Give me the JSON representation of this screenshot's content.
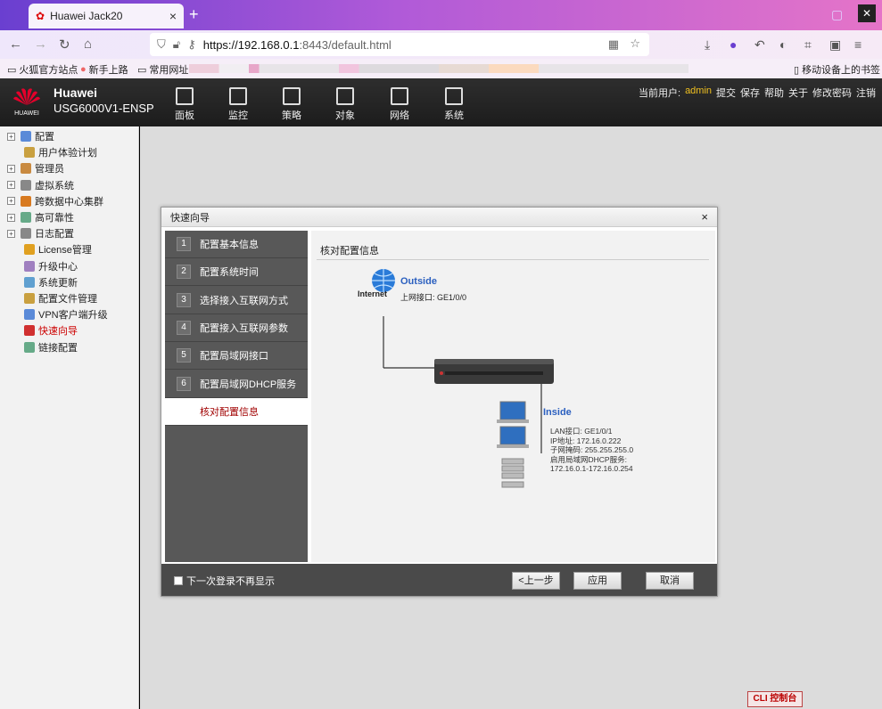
{
  "browser": {
    "tab_title": "Huawei Jack20",
    "url_host": "https://192.168.0.1",
    "url_rest": ":8443/default.html",
    "bookmarks": [
      "火狐官方站点",
      "新手上路",
      "常用网址"
    ],
    "mobile_bookmarks": "移动设备上的书签"
  },
  "header": {
    "brand": "Huawei",
    "model": "USG6000V1-ENSP",
    "logo_text": "HUAWEI",
    "nav": [
      "面板",
      "监控",
      "策略",
      "对象",
      "网络",
      "系统"
    ],
    "current_user_label": "当前用户:",
    "current_user": "admin",
    "actions": [
      "提交",
      "保存",
      "帮助",
      "关于",
      "修改密码",
      "注销"
    ]
  },
  "sidebar": {
    "items": [
      {
        "label": "配置",
        "expand": true
      },
      {
        "label": "用户体验计划",
        "expand": false
      },
      {
        "label": "管理员",
        "expand": true
      },
      {
        "label": "虚拟系统",
        "expand": true
      },
      {
        "label": "跨数据中心集群",
        "expand": true
      },
      {
        "label": "高可靠性",
        "expand": true
      },
      {
        "label": "日志配置",
        "expand": true
      },
      {
        "label": "License管理",
        "expand": false
      },
      {
        "label": "升级中心",
        "expand": false
      },
      {
        "label": "系统更新",
        "expand": false
      },
      {
        "label": "配置文件管理",
        "expand": false
      },
      {
        "label": "VPN客户端升级",
        "expand": false
      },
      {
        "label": "快速向导",
        "expand": false,
        "active": true
      },
      {
        "label": "链接配置",
        "expand": false
      }
    ]
  },
  "dialog": {
    "title": "快速向导",
    "steps": [
      {
        "num": "1",
        "label": "配置基本信息"
      },
      {
        "num": "2",
        "label": "配置系统时间"
      },
      {
        "num": "3",
        "label": "选择接入互联网方式"
      },
      {
        "num": "4",
        "label": "配置接入互联网参数"
      },
      {
        "num": "5",
        "label": "配置局域网接口"
      },
      {
        "num": "6",
        "label": "配置局域网DHCP服务"
      },
      {
        "num": "7",
        "label": "核对配置信息"
      }
    ],
    "panel_title": "核对配置信息",
    "internet_label": "Internet",
    "outside_title": "Outside",
    "outside_detail": "上网接口: GE1/0/0",
    "inside_title": "Inside",
    "inside_lines": [
      "LAN接口: GE1/0/1",
      "IP地址: 172.16.0.222",
      "子网掩码: 255.255.255.0",
      "启用局域网DHCP服务:",
      "172.16.0.1-172.16.0.254"
    ],
    "no_show": "下一次登录不再显示",
    "btn_prev": "<上一步",
    "btn_apply": "应用",
    "btn_cancel": "取消"
  },
  "cli": "CLI 控制台"
}
